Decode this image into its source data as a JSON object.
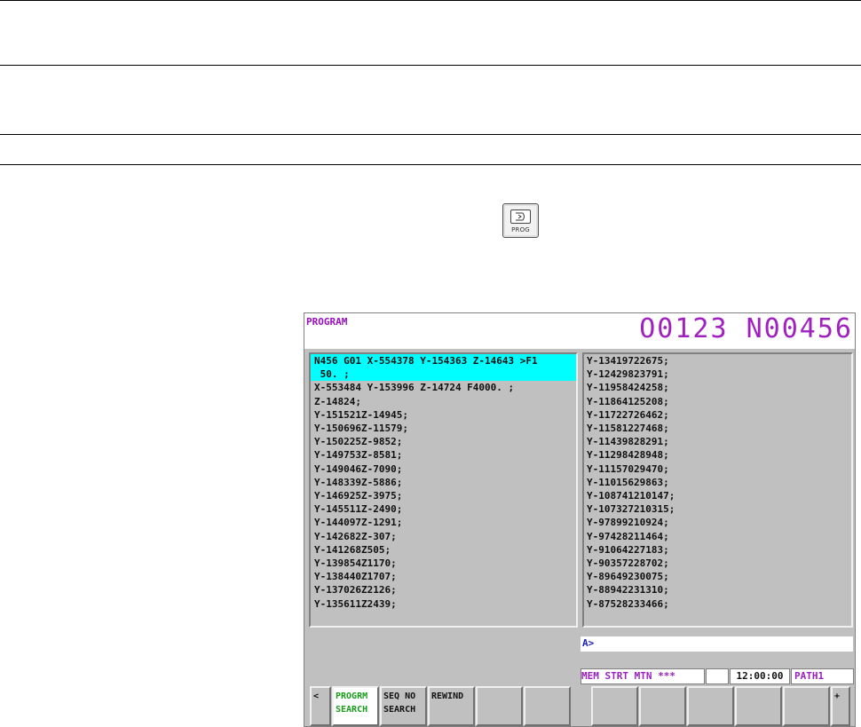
{
  "key": {
    "label": "PROG"
  },
  "screen": {
    "title": "PROGRAM",
    "program_number": "O0123 N00456",
    "left_lines": [
      "N456 G01 X-554378 Y-154363 Z-14643 >F1",
      " 50. ;",
      "X-553484 Y-153996 Z-14724 F4000. ;",
      "Z-14824;",
      "Y-151521Z-14945;",
      "Y-150696Z-11579;",
      "Y-150225Z-9852;",
      "Y-149753Z-8581;",
      "Y-149046Z-7090;",
      "Y-148339Z-5886;",
      "Y-146925Z-3975;",
      "Y-145511Z-2490;",
      "Y-144097Z-1291;",
      "Y-142682Z-307;",
      "Y-141268Z505;",
      "Y-139854Z1170;",
      "Y-138440Z1707;",
      "Y-137026Z2126;",
      "Y-135611Z2439;"
    ],
    "right_lines": [
      "Y-13419722675;",
      "Y-12429823791;",
      "Y-11958424258;",
      "Y-11864125208;",
      "Y-11722726462;",
      "Y-11581227468;",
      "Y-11439828291;",
      "Y-11298428948;",
      "Y-11157029470;",
      "Y-11015629863;",
      "Y-108741210147;",
      "Y-107327210315;",
      "Y-97899210924;",
      "Y-97428211464;",
      "Y-91064227183;",
      "Y-90357228702;",
      "Y-89649230075;",
      "Y-88942231310;",
      "Y-87528233466;"
    ],
    "command_prompt": "A>",
    "status": {
      "mode": " MEM  STRT MTN  ***",
      "blank": "",
      "time": "12:00:00",
      "path": "PATH1"
    },
    "softkeys": {
      "left_arrow": "<",
      "k1_line1": "PROGRM",
      "k1_line2": "SEARCH",
      "k2_line1": "SEQ NO",
      "k2_line2": "SEARCH",
      "k3_line1": "REWIND",
      "right_arrow": "+"
    }
  }
}
